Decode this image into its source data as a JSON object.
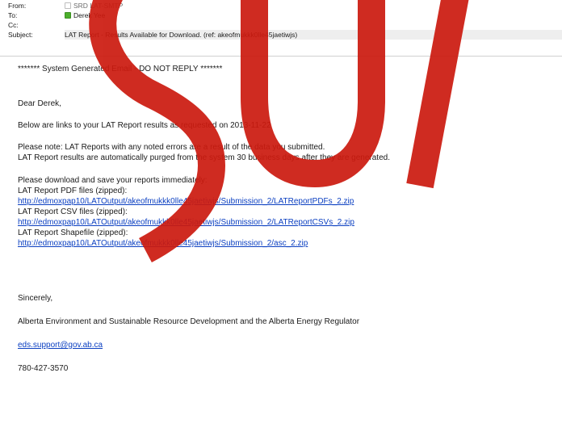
{
  "header": {
    "from_label": "From:",
    "from_value": "SRD LAT-SMTP",
    "to_label": "To:",
    "to_value": "Derek Yee",
    "cc_label": "Cc:",
    "cc_value": "",
    "subject_label": "Subject:",
    "subject_value": "LAT Report - Results Available for Download. (ref: akeofmukkk0lle45jaetiwjs)"
  },
  "body": {
    "banner": "******* System Generated Email - DO NOT REPLY *******",
    "greeting": "Dear Derek,",
    "intro": "Below are links to your LAT Report results as requested on 2013-11-22",
    "note1": "Please note: LAT Reports with any noted errors are a result of the data you submitted.",
    "note2": "LAT Report results are automatically purged from the system 30 business days after they are generated.",
    "download_intro": "Please download and save your reports immediately:",
    "pdf_label": "LAT Report PDF files (zipped):",
    "pdf_link": "http://edmoxpap10/LATOutput/akeofmukkk0lle45jaetiwjs/Submission_2/LATReportPDFs_2.zip",
    "csv_label": "LAT Report CSV files (zipped):",
    "csv_link": "http://edmoxpap10/LATOutput/akeofmukkk0lle45jaetiwjs/Submission_2/LATReportCSVs_2.zip",
    "shp_label": "LAT Report Shapefile (zipped):",
    "shp_link": "http://edmoxpap10/LATOutput/akeofmukkk0lle45jaetiwjs/Submission_2/asc_2.zip",
    "closing": "Sincerely,",
    "org": "Alberta Environment and Sustainable Resource Development and the Alberta Energy Regulator",
    "email": "eds.support@gov.ab.ca",
    "phone": "780-427-3570"
  },
  "colors": {
    "link": "#0b3fc1",
    "watermark": "#cc1a0f",
    "presence_online": "#4caf2c"
  },
  "icons": {
    "from_presence": "presence-offline-icon",
    "to_presence": "presence-online-icon"
  }
}
